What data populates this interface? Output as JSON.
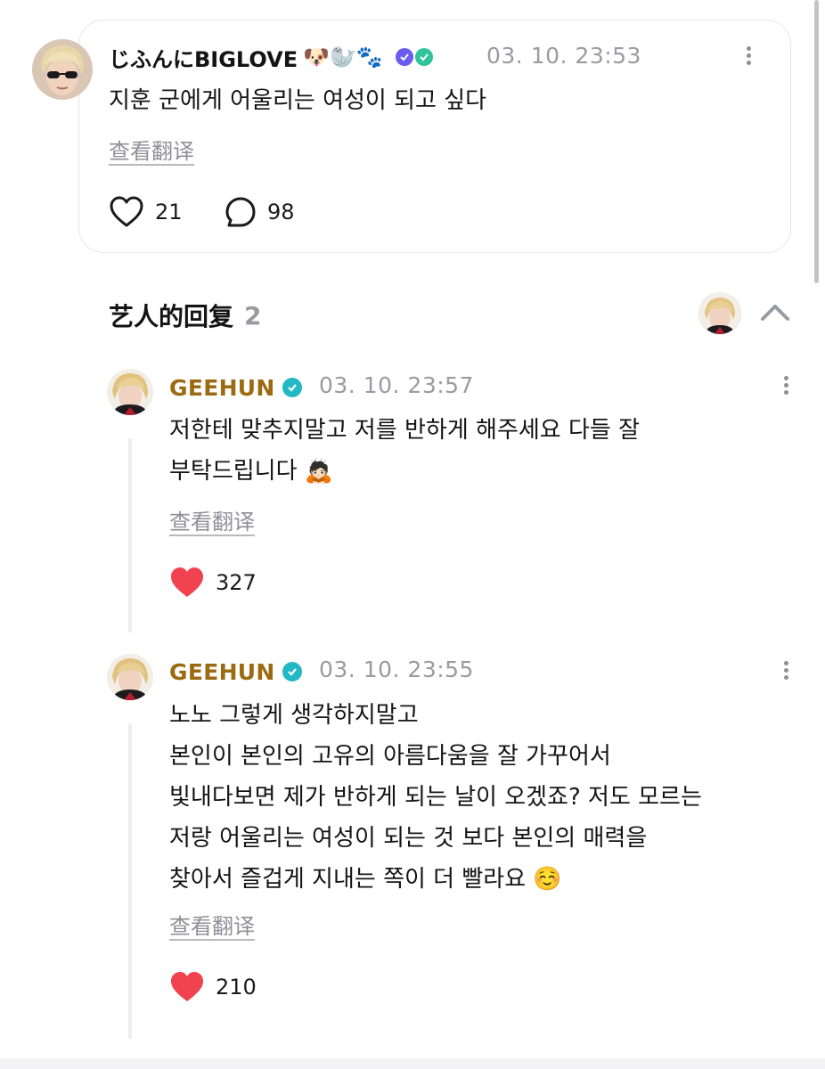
{
  "post": {
    "author": "じふんにBIGLOVE",
    "author_emojis": "🐶🦭🐾",
    "timestamp": "03. 10. 23:53",
    "text": "지훈 군에게 어울리는 여성이 되고 싶다",
    "translate_label": "查看翻译",
    "likes": "21",
    "comments": "98"
  },
  "replies_section": {
    "title": "艺人的回复",
    "count": "2"
  },
  "replies": [
    {
      "author": "GEEHUN",
      "timestamp": "03. 10. 23:57",
      "lines": [
        "저한테 맞추지말고 저를 반하게 해주세요 다들 잘",
        "부탁드립니다 🙇🏻"
      ],
      "translate_label": "查看翻译",
      "likes": "327"
    },
    {
      "author": "GEEHUN",
      "timestamp": "03. 10. 23:55",
      "lines": [
        "노노 그렇게 생각하지말고",
        "본인이 본인의 고유의 아름다움을 잘 가꾸어서",
        "빛내다보면 제가 반하게 되는 날이 오겠죠? 저도 모르는",
        "저랑 어울리는 여성이 되는 것 보다 본인의 매력을",
        "찾아서 즐겁게 지내는 쪽이 더 빨라요 ☺️"
      ],
      "translate_label": "查看翻译",
      "likes": "210"
    }
  ],
  "colors": {
    "artist_name": "#9b6a11",
    "heart_filled": "#f0424f",
    "verified_badge": "#22b8c4",
    "meta_gray": "#9a9aa2"
  },
  "icons": {
    "like_outline": "heart-outline-icon",
    "comment": "speech-bubble-icon",
    "like_filled": "heart-filled-icon",
    "collapse": "chevron-up-icon",
    "more": "more-vertical-icon",
    "verified": "verified-check-icon"
  }
}
